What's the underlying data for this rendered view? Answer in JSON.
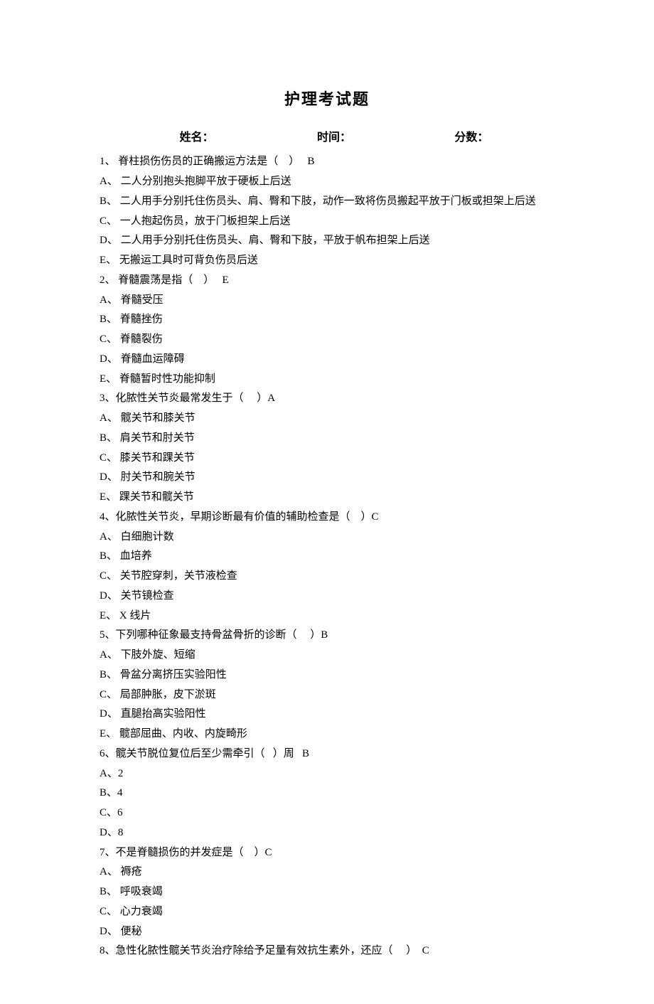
{
  "title": "护理考试题",
  "header": {
    "name_label": "姓名：",
    "time_label": "时间：",
    "score_label": "分数："
  },
  "questions": [
    {
      "stem": "1、 脊柱损伤伤员的正确搬运方法是（    ）   B",
      "options": [
        "A、 二人分别抱头抱脚平放于硬板上后送",
        "B、 二人用手分别托住伤员头、肩、臀和下肢，动作一致将伤员搬起平放于门板或担架上后送",
        "C、 一人抱起伤员，放于门板担架上后送",
        "D、 二人用手分别托住伤员头、肩、臀和下肢，平放于帆布担架上后送",
        "E、 无搬运工具时可背负伤员后送"
      ]
    },
    {
      "stem": "2、 脊髓震荡是指（    ）   E",
      "options": [
        "A、 脊髓受压",
        "B、 脊髓挫伤",
        "C、 脊髓裂伤",
        "D、 脊髓血运障碍",
        "E、 脊髓暂时性功能抑制"
      ]
    },
    {
      "stem": "3、化脓性关节炎最常发生于（     ）A",
      "options": [
        "A、 髋关节和膝关节",
        "B、 肩关节和肘关节",
        "C、 膝关节和踝关节",
        "D、 肘关节和腕关节",
        "E、 踝关节和髋关节"
      ]
    },
    {
      "stem": "4、化脓性关节炎，早期诊断最有价值的辅助检查是（    ）C",
      "options": [
        "A、 白细胞计数",
        "B、 血培养",
        "C、 关节腔穿刺，关节液检查",
        "D、 关节镜检查",
        "E、 X 线片"
      ]
    },
    {
      "stem": "5、下列哪种征象最支持骨盆骨折的诊断（     ）B",
      "options": [
        "A、 下肢外旋、短缩",
        "B、 骨盆分离挤压实验阳性",
        "C、 局部肿胀，皮下淤斑",
        "D、 直腿抬高实验阳性",
        "E、 髋部屈曲、内收、内旋畸形"
      ]
    },
    {
      "stem": "6、髋关节脱位复位后至少需牵引（   ）周   B",
      "options": [
        "A、2",
        "B、4",
        "C、6",
        "D、8"
      ]
    },
    {
      "stem": "7、不是脊髓损伤的并发症是（    ）C",
      "options": [
        "A、 褥疮",
        "B、 呼吸衰竭",
        "C、 心力衰竭",
        "D、 便秘"
      ]
    },
    {
      "stem": "8、急性化脓性髋关节炎治疗除给予足量有效抗生素外，还应（     ）  C",
      "options": []
    }
  ]
}
